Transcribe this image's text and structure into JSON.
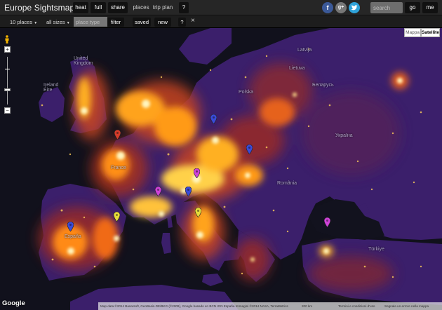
{
  "app": {
    "title": "Europe Sightsmap"
  },
  "topbar": {
    "heat": "heat",
    "full": "full",
    "share": "share",
    "places": "places",
    "trip_plan": "trip plan",
    "help": "?",
    "search_placeholder": "search",
    "go": "go",
    "me": "me",
    "social": {
      "facebook": "f",
      "google": "g+",
      "twitter": "t"
    },
    "colors": {
      "facebook": "#3b5998",
      "google": "#777777",
      "twitter": "#2fa2d9"
    }
  },
  "subbar": {
    "places_select": "10 places",
    "sizes_select": "all sizes",
    "place_type_placeholder": "place type",
    "filter": "filter",
    "saved": "saved",
    "new": "new",
    "help": "?",
    "close": "×"
  },
  "map": {
    "map_type": {
      "map": "Mappa",
      "satellite": "Satellite",
      "selected": "Satellite"
    },
    "zoom": {
      "in": "+",
      "out": "−"
    },
    "country_labels": {
      "uk": "United\nKingdom",
      "ireland": "Ireland\nÉire",
      "france": "France",
      "spain": "España",
      "poland": "Polska",
      "ukraine": "Україна",
      "belarus": "Беларусь",
      "latvia": "Latvija",
      "lithuania": "Lietuva",
      "turkey": "Türkiye",
      "romania": "România"
    },
    "pins": [
      {
        "color": "#d43b2a"
      },
      {
        "color": "#3a4bd8"
      },
      {
        "color": "#3a4bd8"
      },
      {
        "color": "#cf42d8"
      },
      {
        "color": "#cf42d8"
      },
      {
        "color": "#3a4bd8"
      },
      {
        "color": "#e6dc3a"
      },
      {
        "color": "#e6dc3a"
      },
      {
        "color": "#3a4bd8"
      },
      {
        "color": "#cf42d8"
      }
    ],
    "attribution": {
      "data": "Map data ©2014 Basarsoft, GeoBasis-DE/BKG (©2009), Google basado en BCN IGN España Immagini ©2014 NASA, TerraMetrics",
      "scale": "200 km",
      "terms": "Termini e condizioni d'uso",
      "report": "Segnala un errore nella mappa"
    },
    "google": "Google"
  }
}
